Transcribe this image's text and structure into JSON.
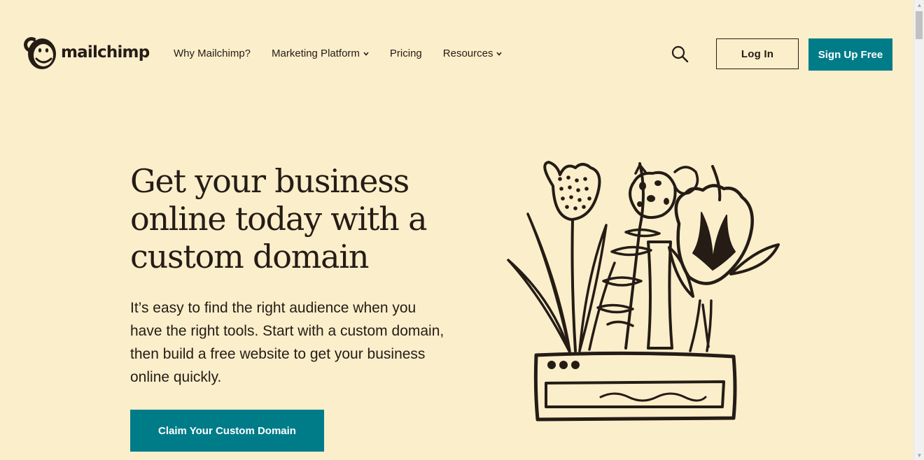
{
  "brand": {
    "name": "mailchimp",
    "logo_icon": "freddie-chimp-icon"
  },
  "nav": {
    "items": [
      {
        "label": "Why Mailchimp?",
        "dropdown": false
      },
      {
        "label": "Marketing Platform",
        "dropdown": true
      },
      {
        "label": "Pricing",
        "dropdown": false
      },
      {
        "label": "Resources",
        "dropdown": true
      }
    ],
    "search_icon": "search-icon",
    "login_label": "Log In",
    "signup_label": "Sign Up Free"
  },
  "hero": {
    "title": "Get your business online today with a custom domain",
    "body": "It’s easy to find the right audience when you have the right tools. Start with a custom domain, then build a free website to get your business online quickly.",
    "cta_label": "Claim Your Custom Domain",
    "illustration": "flowers-in-planter-illustration"
  },
  "colors": {
    "background": "#fbeecb",
    "accent": "#007c89",
    "text": "#241c15"
  }
}
